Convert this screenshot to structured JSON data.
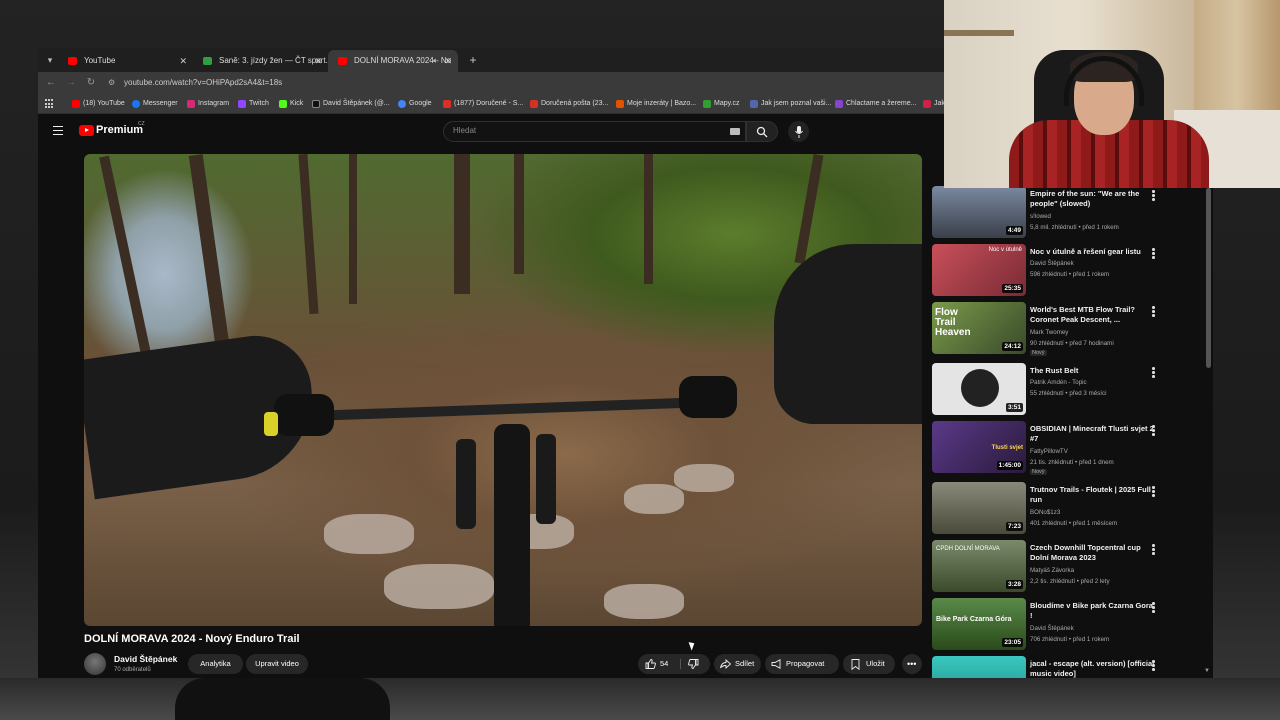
{
  "browser": {
    "tabs": [
      {
        "label": "YouTube",
        "color": "#ff0000"
      },
      {
        "label": "Saně: 3. jízdy žen — ČT sport...",
        "color": "#2ea043"
      },
      {
        "label": "DOLNÍ MORAVA 2024 - No",
        "color": "#ff0000"
      }
    ],
    "url": "youtube.com/watch?v=OHiPApd2sA4&t=18s",
    "bookmarks": [
      {
        "label": "(18) YouTube",
        "color": "#ff0000"
      },
      {
        "label": "Messenger",
        "color": "#1877f2"
      },
      {
        "label": "Instagram",
        "color": "#d62976"
      },
      {
        "label": "Twitch",
        "color": "#9146ff"
      },
      {
        "label": "Kick",
        "color": "#53fc18"
      },
      {
        "label": "David Štěpánek (@...",
        "color": "#111111"
      },
      {
        "label": "Google",
        "color": "#4285f4"
      },
      {
        "label": "(1877) Doručené - S...",
        "color": "#d93025"
      },
      {
        "label": "Doručená pošta (23...",
        "color": "#d93025"
      },
      {
        "label": "Moje inzeráty | Bazo...",
        "color": "#e65100"
      },
      {
        "label": "Mapy.cz",
        "color": "#30a030"
      },
      {
        "label": "Jak jsem poznal vaši...",
        "color": "#5566aa"
      },
      {
        "label": "Chlactame a žereme...",
        "color": "#8844cc"
      },
      {
        "label": "Jak",
        "color": "#cc2244"
      }
    ]
  },
  "youtube": {
    "brand": "Premium",
    "region": "CZ",
    "search_placeholder": "Hledat"
  },
  "video": {
    "title": "DOLNÍ MORAVA 2024 - Nový Enduro Trail",
    "channel": "David Štěpánek",
    "subscribers": "70 odběratelů",
    "analytics_label": "Analytika",
    "edit_label": "Upravit video",
    "likes": "54",
    "share_label": "Sdílet",
    "promote_label": "Propagovat",
    "save_label": "Uložit"
  },
  "related": [
    {
      "title": "Empire of the sun: \"We are the people\" (slowed)",
      "channel": "s!lowed",
      "meta": "5,8 mil. zhlédnutí • před 1 rokem",
      "duration": "4:49",
      "new": "",
      "thumb": "#4a5060"
    },
    {
      "title": "Noc v útulně a řešení gear listu",
      "channel": "David Štěpánek",
      "meta": "596 zhlédnutí • před 1 rokem",
      "duration": "25:35",
      "new": "",
      "thumb": "#b3424a",
      "thumb_text": "Noc v útulně"
    },
    {
      "title": "World's Best MTB Flow Trail? Coronet Peak Descent, ...",
      "channel": "Mark Twomey",
      "meta": "90 zhlédnutí • před 7 hodinami",
      "duration": "24:12",
      "new": "Nový",
      "thumb": "#5a6a3a",
      "thumb_text": "Flow Trail Heaven"
    },
    {
      "title": "The Rust Belt",
      "channel": "Patrik Amdén - Topic",
      "meta": "55 zhlédnutí • před 3 měsíci",
      "duration": "3:51",
      "new": "",
      "thumb": "#d8d8d8"
    },
    {
      "title": "OBSIDIAN | Minecraft Tlusti svjet 2 #7",
      "channel": "FattyPillowTV",
      "meta": "21 tis. zhlédnutí • před 1 dnem",
      "duration": "1:45:00",
      "new": "Nový",
      "thumb": "#3a2a5a",
      "thumb_text": "Tlusti svjet"
    },
    {
      "title": "Trutnov Trails - Floutek | 2025 Full run",
      "channel": "BONo$1z3",
      "meta": "401 zhlédnutí • před 1 měsícem",
      "duration": "7:23",
      "new": "",
      "thumb": "#6a6a5a"
    },
    {
      "title": "Czech Downhill Topcentral cup Dolní Morava 2023",
      "channel": "Matyáš Závorka",
      "meta": "2,2 tis. zhlédnutí • před 2 lety",
      "duration": "3:28",
      "new": "",
      "thumb": "#5a6a4a",
      "thumb_text": "CPDH DOLNÍ MORAVA"
    },
    {
      "title": "Bloudíme v Bike park Czarna Gora !",
      "channel": "David Štěpánek",
      "meta": "706 zhlédnutí • před 1 rokem",
      "duration": "23:05",
      "new": "",
      "thumb": "#4a7a3a",
      "thumb_text": "Bike Park Czarna Góra"
    },
    {
      "title": "jacal - escape (alt. version) [official music video]",
      "channel": "",
      "meta": "",
      "duration": "",
      "new": "",
      "thumb": "#2ab8b0"
    }
  ]
}
